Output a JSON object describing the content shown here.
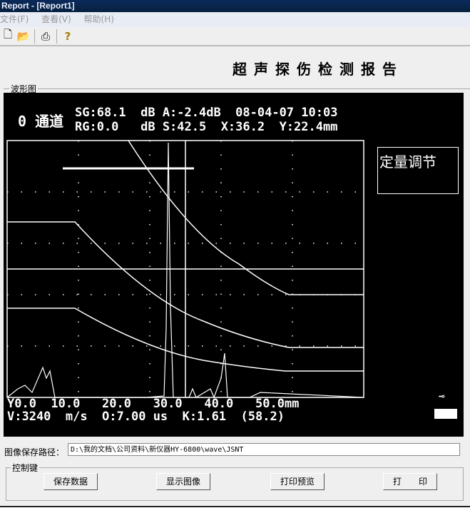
{
  "window": {
    "title": "Report - [Report1]"
  },
  "menu": [
    "文件(F)",
    "查看(V)",
    "帮助(H)"
  ],
  "toolbar": {
    "icons": [
      "new-icon",
      "open-icon",
      "print-icon",
      "help-icon"
    ]
  },
  "report_title": "超声探伤检测报告",
  "waveform": {
    "group_label": "波形图",
    "channel": "0 通道",
    "line1": "SG:68.1  dB A:-2.4dB  08-04-07 10:03",
    "line2": "RG:0.0   dB S:42.5  X:36.2  Y:22.4mm",
    "box_label": "定量调节",
    "x_axis": "Y0.0  10.0   20.0   30.0   40.0   50.0mm",
    "bottom": "V:3240  m/s  O:7.00 us  K:1.61  (58.2)"
  },
  "path": {
    "label": "图像保存路径：",
    "value": "D:\\我的文档\\公司资料\\新仪器HY-6800\\wave\\JSNT"
  },
  "controls": {
    "label": "控制键",
    "save": "保存数据",
    "show": "显示图像",
    "preview": "打印预览",
    "print": "打　　印"
  }
}
